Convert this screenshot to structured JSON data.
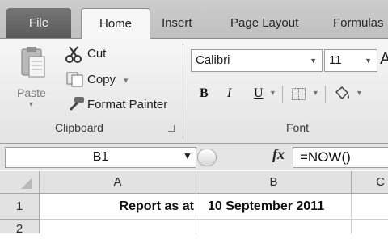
{
  "tabs": {
    "file": "File",
    "home": "Home",
    "insert": "Insert",
    "page_layout": "Page Layout",
    "formulas": "Formulas"
  },
  "clipboard": {
    "cut": "Cut",
    "copy": "Copy",
    "copy_caret": "▾",
    "format_painter": "Format Painter",
    "paste": "Paste",
    "paste_caret": "▾",
    "group_label": "Clipboard"
  },
  "font": {
    "family": "Calibri",
    "size": "11",
    "bold": "B",
    "italic": "I",
    "underline": "U",
    "group_label": "Font"
  },
  "formula_bar": {
    "name_box": "B1",
    "fx": "fx",
    "formula": "=NOW()"
  },
  "sheet": {
    "columns": [
      "A",
      "B",
      "C"
    ],
    "rows": [
      "1",
      "2"
    ],
    "cells": {
      "A1": "Report as at",
      "B1": "10 September 2011"
    }
  }
}
